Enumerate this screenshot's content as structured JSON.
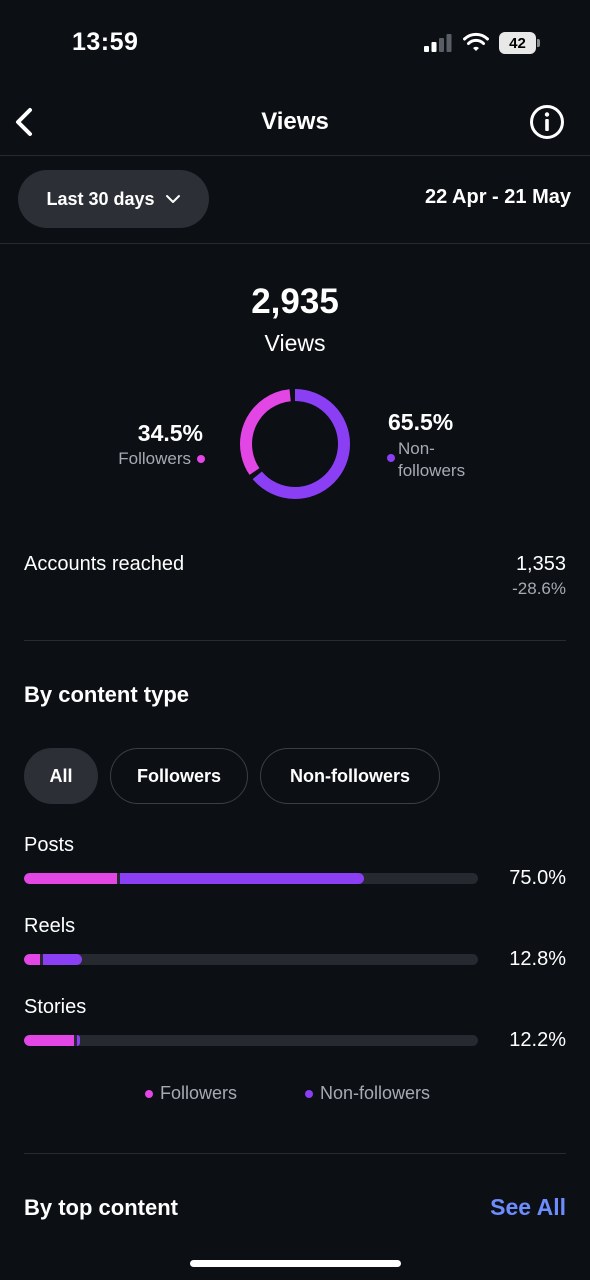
{
  "status_bar": {
    "time": "13:59",
    "battery": "42"
  },
  "header": {
    "title": "Views"
  },
  "date_filter": {
    "label": "Last 30 days",
    "range": "22 Apr - 21 May"
  },
  "summary": {
    "total": "2,935",
    "total_label": "Views",
    "followers_pct": "34.5%",
    "followers_label": "Followers",
    "followers_fraction": 0.345,
    "nonfollowers_pct": "65.5%",
    "nonfollowers_label": "Non-followers",
    "nonfollowers_fraction": 0.655
  },
  "accounts_reached": {
    "label": "Accounts reached",
    "value": "1,353",
    "change": "-28.6%"
  },
  "by_content_type": {
    "title": "By content type",
    "filters": [
      "All",
      "Followers",
      "Non-followers"
    ],
    "active_filter": "All",
    "rows": [
      {
        "label": "Posts",
        "pct": "75.0%",
        "followers_fraction": 0.205,
        "nonfollowers_fraction": 0.545
      },
      {
        "label": "Reels",
        "pct": "12.8%",
        "followers_fraction": 0.035,
        "nonfollowers_fraction": 0.093
      },
      {
        "label": "Stories",
        "pct": "12.2%",
        "followers_fraction": 0.11,
        "nonfollowers_fraction": 0.012
      }
    ],
    "legend": [
      "Followers",
      "Non-followers"
    ]
  },
  "by_top_content": {
    "title": "By top content",
    "see_all": "See All"
  },
  "colors": {
    "followers": "#e246e5",
    "nonfollowers": "#8a3ff5",
    "link": "#6d8dff",
    "background": "#0c0f14"
  }
}
